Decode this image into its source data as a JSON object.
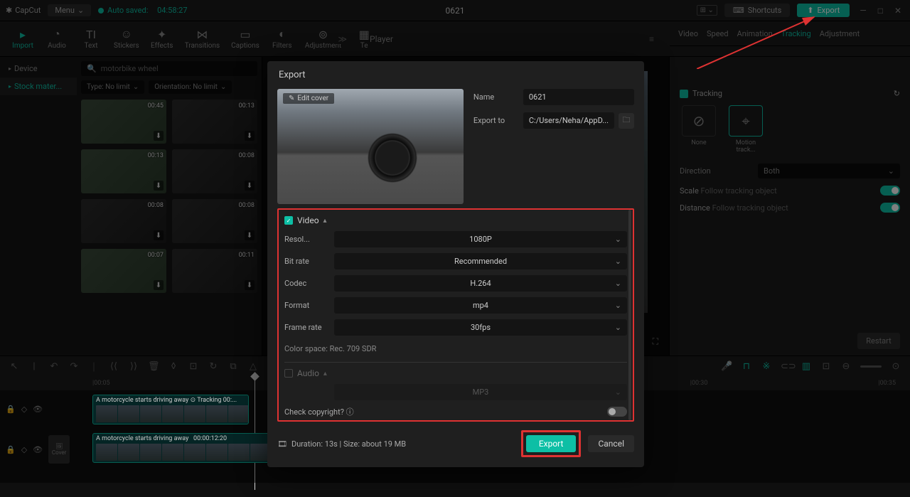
{
  "app": {
    "name": "CapCut",
    "menu": "Menu",
    "auto_saved": "Auto saved:",
    "auto_saved_time": "04:58:27",
    "title": "0621"
  },
  "top_right": {
    "shortcuts": "Shortcuts",
    "export": "Export"
  },
  "toolbar": {
    "items": [
      {
        "label": "Import",
        "active": true
      },
      {
        "label": "Audio"
      },
      {
        "label": "Text"
      },
      {
        "label": "Stickers"
      },
      {
        "label": "Effects"
      },
      {
        "label": "Transitions"
      },
      {
        "label": "Captions"
      },
      {
        "label": "Filters"
      },
      {
        "label": "Adjustment"
      },
      {
        "label": "Te"
      }
    ]
  },
  "player_label": "Player",
  "sidebar": {
    "items": [
      {
        "label": "Device"
      },
      {
        "label": "Stock mater..."
      }
    ]
  },
  "search": {
    "value": "motorbike wheel"
  },
  "filters": {
    "type": "Type: No limit",
    "orientation": "Orientation: No limit"
  },
  "media_times": [
    "00:45",
    "00:13",
    "00:13",
    "00:08",
    "00:08",
    "00:08",
    "00:07",
    "00:11"
  ],
  "right_tabs": [
    "Video",
    "Speed",
    "Animation",
    "Tracking",
    "Adjustment"
  ],
  "tracking": {
    "title": "Tracking",
    "modes": {
      "none": "None",
      "motion": "Motion track..."
    },
    "direction_label": "Direction",
    "direction_value": "Both",
    "scale_label": "Scale",
    "scale_value": "Follow tracking object",
    "distance_label": "Distance",
    "distance_value": "Follow tracking object",
    "restart": "Restart"
  },
  "modal": {
    "title": "Export",
    "edit_cover": "Edit cover",
    "name_label": "Name",
    "name_value": "0621",
    "export_to_label": "Export to",
    "export_to_value": "C:/Users/Neha/AppD...",
    "video_section": "Video",
    "resolution_label": "Resol...",
    "resolution_value": "1080P",
    "bitrate_label": "Bit rate",
    "bitrate_value": "Recommended",
    "codec_label": "Codec",
    "codec_value": "H.264",
    "format_label": "Format",
    "format_value": "mp4",
    "framerate_label": "Frame rate",
    "framerate_value": "30fps",
    "color_space": "Color space: Rec. 709 SDR",
    "audio_section": "Audio",
    "audio_format_value": "MP3",
    "copyright_label": "Check copyright?",
    "duration": "Duration: 13s | Size: about 19 MB",
    "export_btn": "Export",
    "cancel_btn": "Cancel"
  },
  "timeline": {
    "marks": [
      "|00:05",
      "|00:30",
      "|00:35"
    ],
    "clip1_label": "A motorcycle starts driving away",
    "clip1_tracking": "Tracking",
    "clip1_time": "00:...",
    "clip2_label": "A motorcycle starts driving away",
    "clip2_time": "00:00:12:20",
    "cover": "Cover"
  }
}
